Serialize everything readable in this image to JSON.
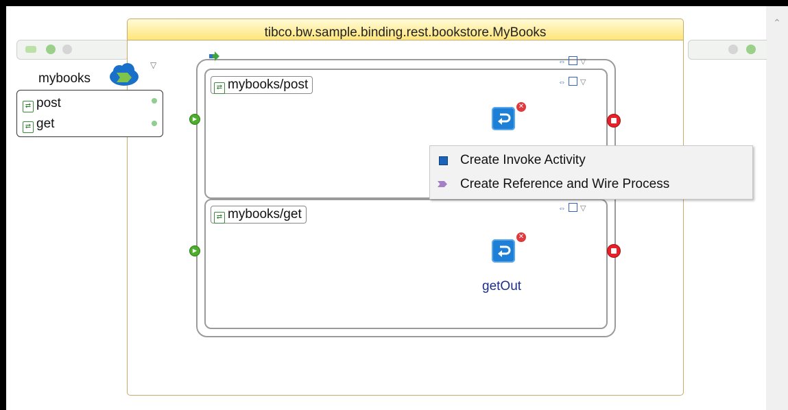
{
  "composite": {
    "title": "tibco.bw.sample.binding.rest.bookstore.MyBooks"
  },
  "service": {
    "name": "mybooks",
    "operations": [
      {
        "label": "post"
      },
      {
        "label": "get"
      }
    ]
  },
  "processes": [
    {
      "operation_tag": "mybooks/post",
      "reply_label": ""
    },
    {
      "operation_tag": "mybooks/get",
      "reply_label": "getOut"
    }
  ],
  "context_menu": {
    "items": [
      {
        "label": "Create Invoke Activity",
        "icon": "invoke-activity-icon"
      },
      {
        "label": "Create Reference and Wire Process",
        "icon": "reference-icon"
      }
    ]
  },
  "colors": {
    "header_gradient_top": "#fffbd6",
    "header_gradient_bottom": "#ffe57a",
    "reply_blue": "#1d7fd6",
    "end_red": "#e8202a",
    "start_green": "#4cae2a"
  }
}
